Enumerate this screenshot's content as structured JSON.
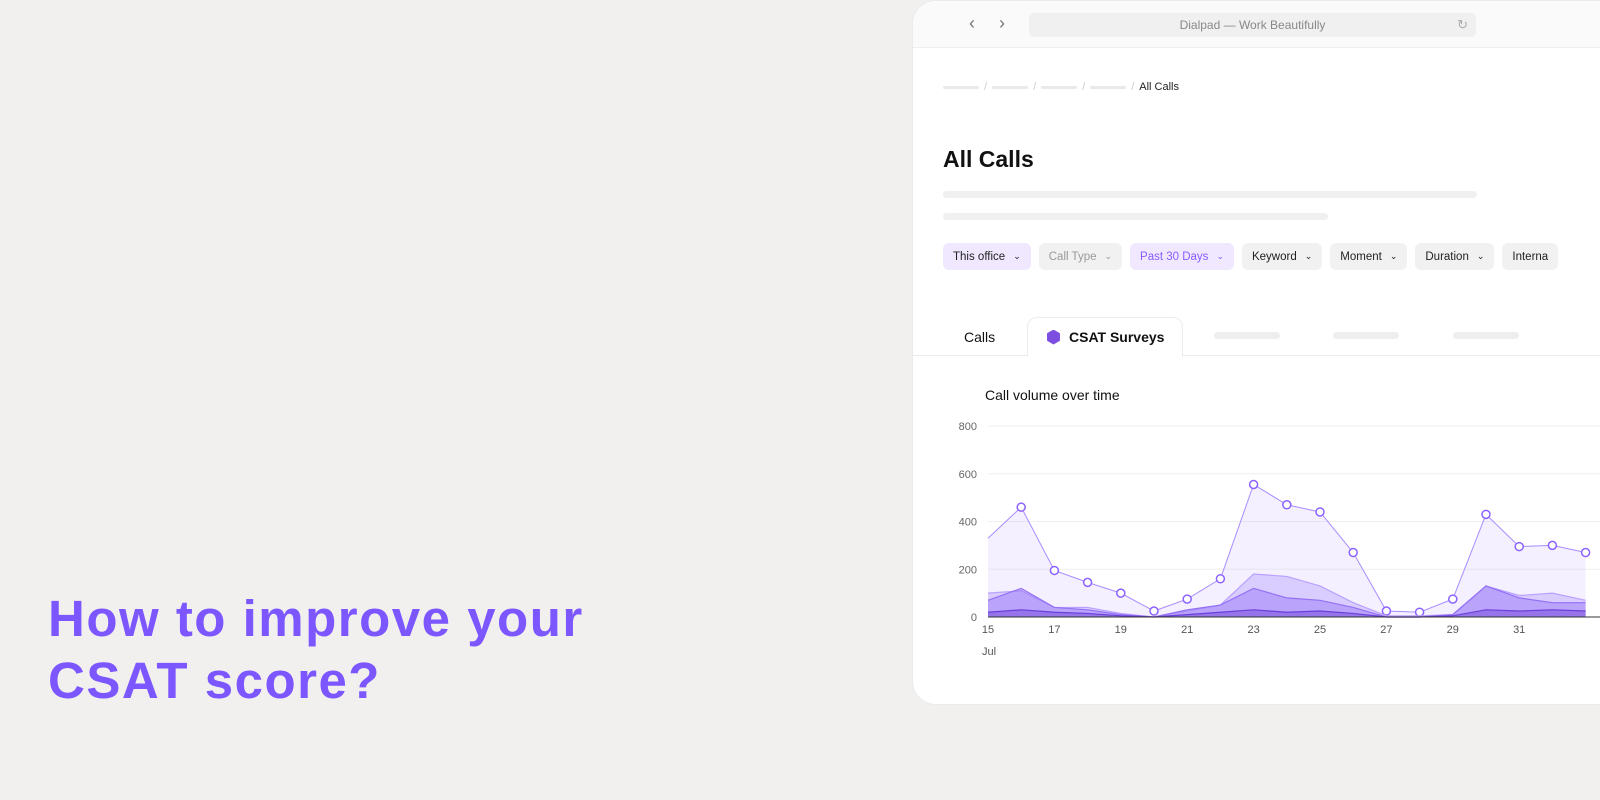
{
  "headline": {
    "line1": "How to improve your",
    "line2": "CSAT score?"
  },
  "browser": {
    "url_title": "Dialpad — Work Beautifully",
    "icons": [
      "chevron-left-icon",
      "chevron-right-icon",
      "reload-icon"
    ]
  },
  "breadcrumb": {
    "current": "All Calls"
  },
  "page": {
    "title": "All Calls"
  },
  "filters": [
    {
      "label": "This office",
      "state": "selected"
    },
    {
      "label": "Call Type",
      "state": "disabled"
    },
    {
      "label": "Past 30 Days",
      "state": "active"
    },
    {
      "label": "Keyword",
      "state": "default"
    },
    {
      "label": "Moment",
      "state": "default"
    },
    {
      "label": "Duration",
      "state": "default"
    },
    {
      "label": "Interna",
      "state": "default"
    }
  ],
  "tabs": {
    "calls": "Calls",
    "csat": "CSAT Surveys"
  },
  "colors": {
    "accent": "#7c56fe",
    "background": "#f1f0ee"
  },
  "chart_data": {
    "type": "area",
    "title": "Call volume over time",
    "xlabel": "Jul",
    "x": [
      15,
      16,
      17,
      18,
      19,
      20,
      21,
      22,
      23,
      24,
      25,
      26,
      27,
      28,
      29,
      30,
      31,
      32,
      33
    ],
    "xticks": [
      "15",
      "17",
      "19",
      "21",
      "23",
      "25",
      "27",
      "29",
      "31"
    ],
    "ylim": [
      0,
      800
    ],
    "yticks": [
      "0",
      "200",
      "400",
      "600",
      "800"
    ],
    "grid": true,
    "series": [
      {
        "values": [
          330,
          460,
          195,
          145,
          100,
          25,
          75,
          160,
          555,
          470,
          440,
          270,
          25,
          20,
          75,
          430,
          295,
          300,
          270
        ],
        "color": "#a98cff"
      },
      {
        "values": [
          100,
          110,
          40,
          40,
          15,
          0,
          25,
          50,
          180,
          170,
          130,
          60,
          5,
          5,
          10,
          130,
          90,
          100,
          70
        ],
        "color": "#b9a0ff"
      },
      {
        "values": [
          70,
          120,
          40,
          30,
          10,
          0,
          30,
          50,
          120,
          80,
          70,
          40,
          0,
          0,
          10,
          130,
          80,
          60,
          60
        ],
        "color": "#9470f5"
      },
      {
        "values": [
          20,
          30,
          20,
          15,
          5,
          0,
          10,
          20,
          30,
          20,
          25,
          15,
          0,
          0,
          5,
          30,
          25,
          30,
          25
        ],
        "color": "#6a3fd9"
      }
    ]
  }
}
